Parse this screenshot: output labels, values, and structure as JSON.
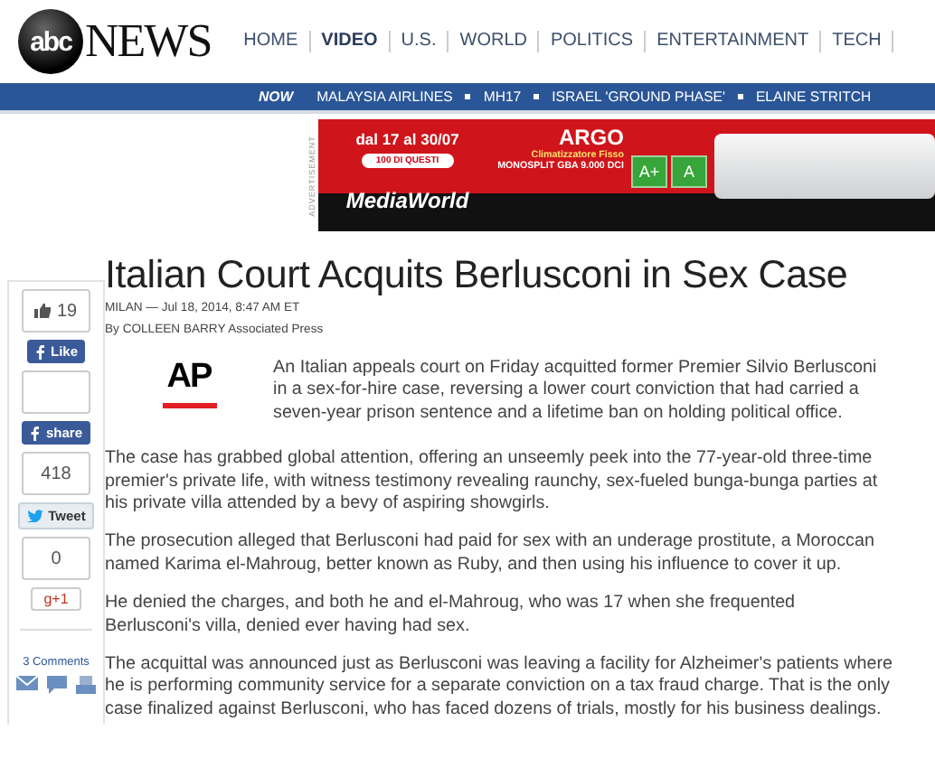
{
  "header": {
    "logo": {
      "mark": "abc",
      "word": "NEWS"
    },
    "nav": [
      {
        "label": "HOME",
        "selected": false
      },
      {
        "label": "VIDEO",
        "selected": true
      },
      {
        "label": "U.S.",
        "selected": false
      },
      {
        "label": "WORLD",
        "selected": false
      },
      {
        "label": "POLITICS",
        "selected": false
      },
      {
        "label": "ENTERTAINMENT",
        "selected": false
      },
      {
        "label": "TECH",
        "selected": false
      }
    ]
  },
  "trending": {
    "label": "NOW",
    "items": [
      "MALAYSIA AIRLINES",
      "MH17",
      "ISRAEL 'GROUND PHASE'",
      "ELAINE STRITCH"
    ]
  },
  "ad": {
    "tag": "ADVERTISEMENT",
    "dates": "dal 17 al 30/07",
    "ribbon": "100 DI QUESTI",
    "store": "MediaWorld",
    "brand": "ARGO",
    "product": "Climatizzatore Fisso",
    "model": "MONOSPLIT GBA 9.000 DCI",
    "ratings": [
      "A+",
      "A"
    ]
  },
  "share": {
    "like_count": "19",
    "like": "Like",
    "share": "share",
    "share_count": "418",
    "tweet": "Tweet",
    "plus_count": "0",
    "plus": "g+1",
    "comments": "3 Comments"
  },
  "article": {
    "title": "Italian Court Acquits Berlusconi in Sex Case",
    "dateline": "MILAN — Jul 18, 2014, 8:47 AM ET",
    "byline": "By COLLEEN BARRY Associated Press",
    "source_logo": "AP",
    "paragraphs": [
      "An Italian appeals court on Friday acquitted former Premier Silvio Berlusconi in a sex-for-hire case, reversing a lower court conviction that had carried a seven-year prison sentence and a lifetime ban on holding political office.",
      "The case has grabbed global attention, offering an unseemly peek into the 77-year-old three-time premier's private life, with witness testimony revealing raunchy, sex-fueled bunga-bunga parties at his private villa attended by a bevy of aspiring showgirls.",
      "The prosecution alleged that Berlusconi had paid for sex with an underage prostitute, a Moroccan named Karima el-Mahroug, better known as Ruby, and then using his influence to cover it up.",
      "He denied the charges, and both he and el-Mahroug, who was 17 when she frequented Berlusconi's villa, denied ever having had sex.",
      "The acquittal was announced just as Berlusconi was leaving a facility for Alzheimer's patients where he is performing community service for a separate conviction on a tax fraud charge. That is the only case finalized against Berlusconi, who has faced dozens of trials, mostly for his business dealings."
    ]
  }
}
